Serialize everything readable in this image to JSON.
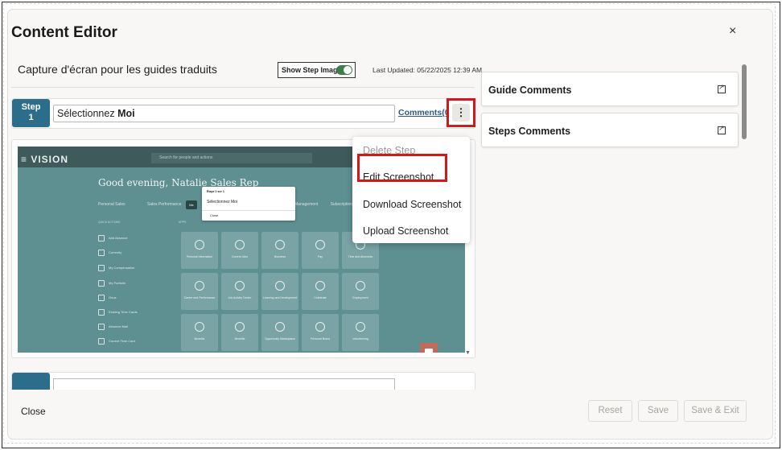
{
  "dialog": {
    "title": "Content Editor",
    "close_glyph": "×"
  },
  "header": {
    "guide_title": "Capture d'écran pour les guides traduits",
    "show_step_images_label": "Show Step Images",
    "show_step_images_on": true,
    "last_updated": "Last Updated: 05/22/2025 12:39 AM"
  },
  "step": {
    "badge_word": "Step",
    "badge_number": "1",
    "text_prefix": "Sélectionnez ",
    "text_bold": "Moi",
    "comments_link": "Comments(0)",
    "kebab_glyph": "⋮"
  },
  "screenshot": {
    "logo": "≡ VISION",
    "search_placeholder": "Search for people and actions",
    "greeting": "Good evening, Natalie Sales Rep",
    "tabs_left": [
      "Personal Sales",
      "Sales Performance"
    ],
    "me_tab": "Me",
    "tabs_right": [
      "Management",
      "Subscriptions"
    ],
    "popup_header": "Étape 1 sur 1",
    "popup_text": "Sélectionnez Moi",
    "popup_close": "Close",
    "quick_actions_heading": "QUICK ACTIONS",
    "apps_heading": "APPS",
    "quick_actions": [
      "Add Absence",
      "Currently",
      "My Compensation",
      "My Portfolio",
      "Onus",
      "Existing Time Cards",
      "Absence Mail",
      "Current Time Card"
    ],
    "tiles": [
      "Personal Information",
      "Current Jobs",
      "Business",
      "Pay",
      "Time and Absences",
      "Career and Performance",
      "Job Activity Center",
      "Learning and Development",
      "Celebrate",
      "Employment",
      "Benefits",
      "Benefits",
      "Opportunity Marketplace",
      "Personal Brand",
      "Volunteering"
    ]
  },
  "context_menu": {
    "items": [
      {
        "label": "Delete Step",
        "enabled": false
      },
      {
        "label": "Edit Screenshot",
        "enabled": true
      },
      {
        "label": "Download Screenshot",
        "enabled": true
      },
      {
        "label": "Upload Screenshot",
        "enabled": true
      }
    ]
  },
  "side_panel": {
    "guide_comments": "Guide Comments",
    "steps_comments": "Steps Comments"
  },
  "footer": {
    "close": "Close",
    "reset": "Reset",
    "save": "Save",
    "save_exit": "Save & Exit"
  },
  "colors": {
    "step_badge": "#2d6d8c",
    "highlight": "#d1191c",
    "toggle_on": "#3d7d4e",
    "link": "#2d5a8a"
  }
}
